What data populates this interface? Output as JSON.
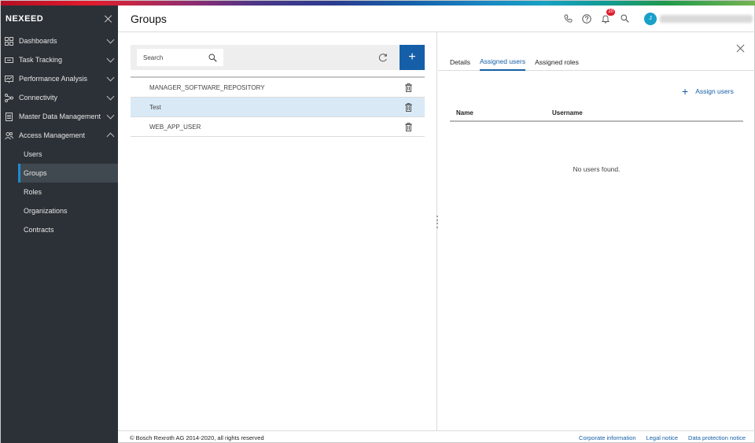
{
  "app": {
    "brand": "NEXEED"
  },
  "sidebar": {
    "items": [
      {
        "label": "Dashboards",
        "icon": "dashboard-icon"
      },
      {
        "label": "Task Tracking",
        "icon": "ticket-icon"
      },
      {
        "label": "Performance Analysis",
        "icon": "monitor-chart-icon"
      },
      {
        "label": "Connectivity",
        "icon": "network-icon"
      },
      {
        "label": "Master Data Management",
        "icon": "document-icon"
      },
      {
        "label": "Access Management",
        "icon": "users-icon",
        "expanded": true
      }
    ],
    "sub_items": [
      {
        "label": "Users"
      },
      {
        "label": "Groups",
        "active": true
      },
      {
        "label": "Roles"
      },
      {
        "label": "Organizations"
      },
      {
        "label": "Contracts"
      }
    ]
  },
  "header": {
    "title": "Groups",
    "notification_count": "20",
    "avatar_initial": "J"
  },
  "list": {
    "search_placeholder": "Search",
    "add_label": "+",
    "rows": [
      {
        "name": "MANAGER_SOFTWARE_REPOSITORY",
        "selected": false
      },
      {
        "name": "Test",
        "selected": true
      },
      {
        "name": "WEB_APP_USER",
        "selected": false
      }
    ]
  },
  "detail": {
    "tabs": [
      {
        "label": "Details",
        "active": false
      },
      {
        "label": "Assigned users",
        "active": true
      },
      {
        "label": "Assigned roles",
        "active": false
      }
    ],
    "assign_label": "Assign users",
    "columns": [
      "Name",
      "Username"
    ],
    "empty_text": "No users found."
  },
  "footer": {
    "copyright": "© Bosch Rexroth AG 2014-2020, all rights reserved",
    "links": [
      "Corporate information",
      "Legal notice",
      "Data protection notice"
    ]
  },
  "colors": {
    "accent": "#155fa8",
    "sidebar": "#2c3137",
    "selected_row": "#d9eaf6",
    "badge": "#e01b2d"
  }
}
